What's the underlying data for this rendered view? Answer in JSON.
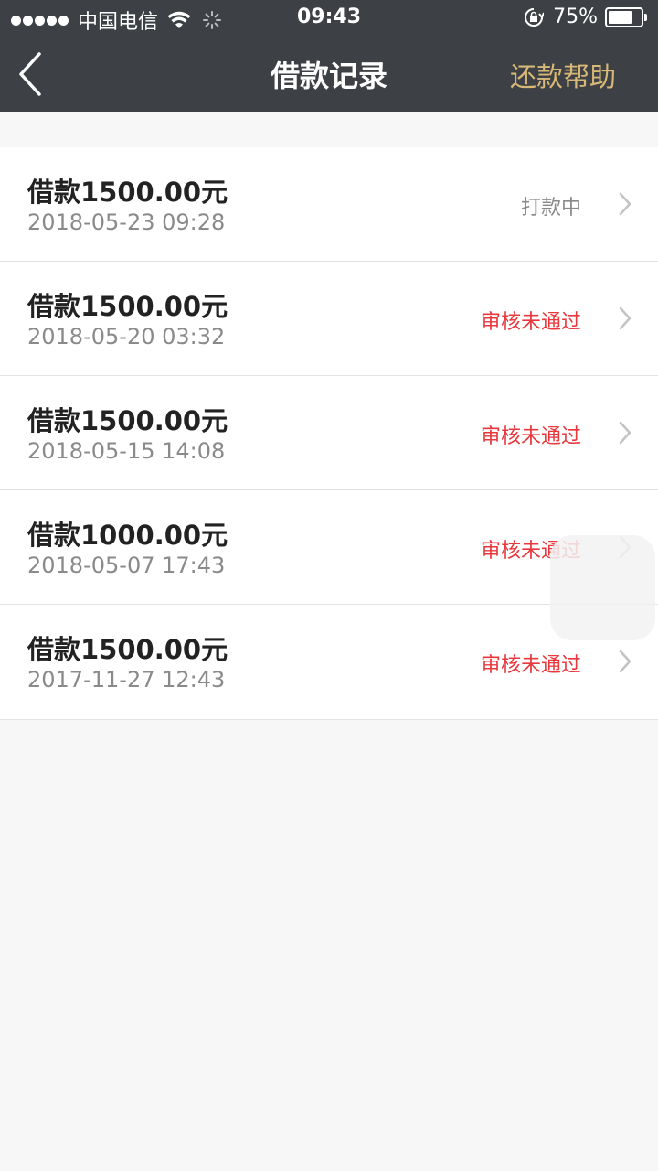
{
  "status_bar": {
    "carrier": "中国电信",
    "time": "09:43",
    "battery_percent": "75%",
    "battery_level": 0.75,
    "signal_dots": 5
  },
  "nav": {
    "title": "借款记录",
    "right_action": "还款帮助",
    "back_icon": "chevron-left-icon"
  },
  "colors": {
    "header_bg": "#3d4044",
    "accent_gold": "#d7b877",
    "rejected_red": "#e8383d",
    "pending_gray": "#8a8a8a",
    "page_bg": "#f7f7f7"
  },
  "records": [
    {
      "amount": "借款1500.00元",
      "datetime": "2018-05-23 09:28",
      "status": "打款中",
      "status_type": "pending"
    },
    {
      "amount": "借款1500.00元",
      "datetime": "2018-05-20 03:32",
      "status": "审核未通过",
      "status_type": "rejected"
    },
    {
      "amount": "借款1500.00元",
      "datetime": "2018-05-15 14:08",
      "status": "审核未通过",
      "status_type": "rejected"
    },
    {
      "amount": "借款1000.00元",
      "datetime": "2018-05-07 17:43",
      "status": "审核未通过",
      "status_type": "rejected"
    },
    {
      "amount": "借款1500.00元",
      "datetime": "2017-11-27 12:43",
      "status": "审核未通过",
      "status_type": "rejected"
    }
  ]
}
